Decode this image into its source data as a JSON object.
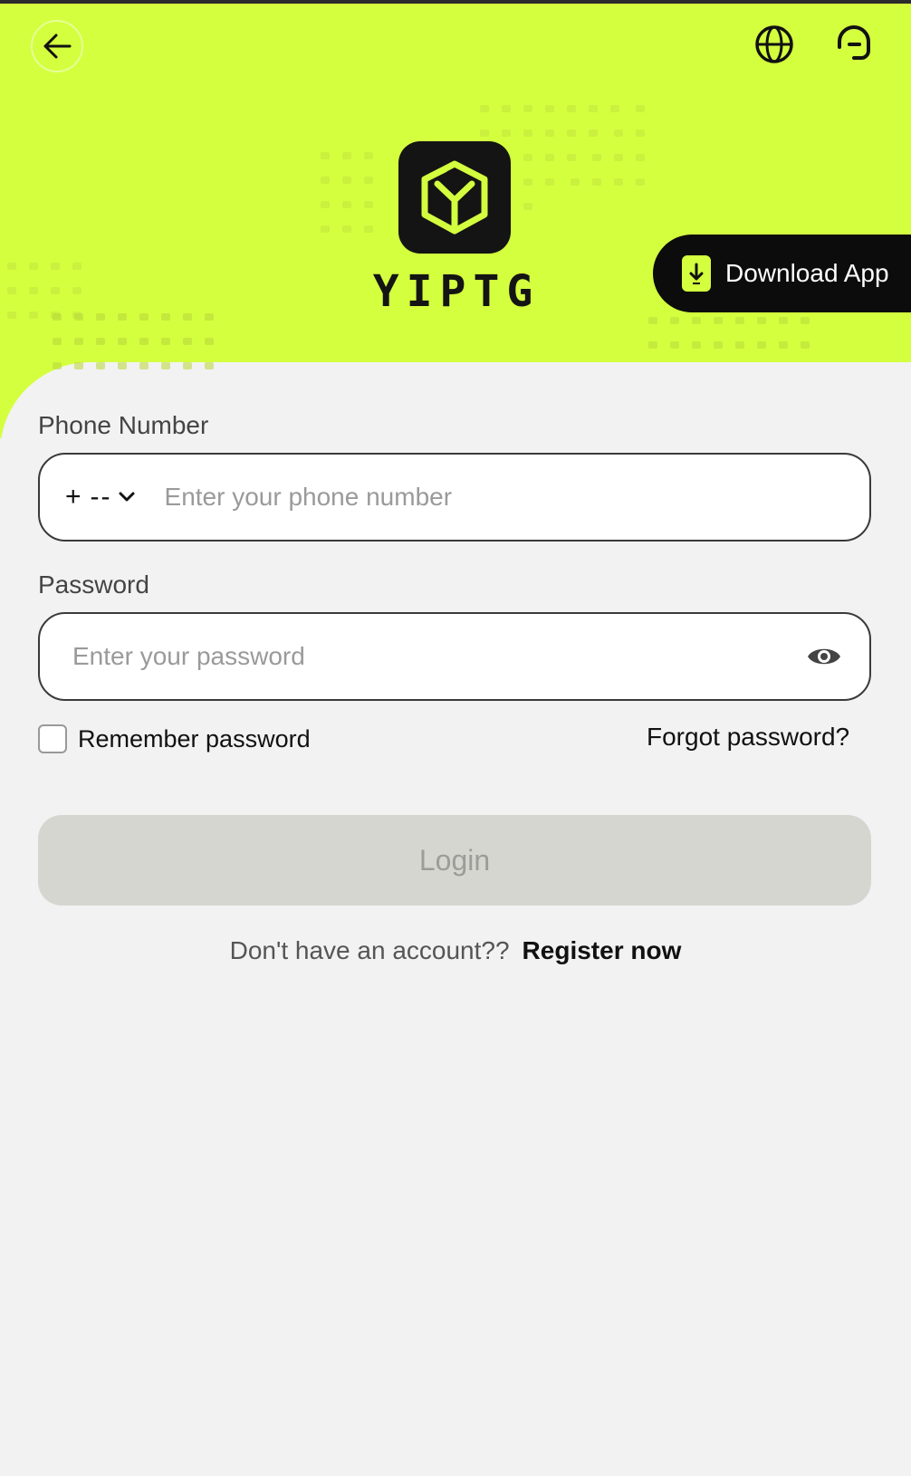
{
  "brand": {
    "name": "YIPTG",
    "accent_color": "#d4ff3f",
    "dark_color": "#141414"
  },
  "header": {
    "back_icon": "arrow-left-icon",
    "language_icon": "globe-icon",
    "support_icon": "headset-icon",
    "download_label": "Download App",
    "download_icon": "phone-download-icon"
  },
  "form": {
    "phone_label": "Phone Number",
    "country_code": {
      "plus": "+",
      "dashes": "--"
    },
    "phone_placeholder": "Enter your phone number",
    "password_label": "Password",
    "password_placeholder": "Enter your password",
    "password_toggle_icon": "eye-icon",
    "remember_label": "Remember password",
    "forgot_label": "Forgot password?",
    "login_label": "Login"
  },
  "footer": {
    "no_account_text": "Don't have an account??",
    "register_label": "Register now"
  }
}
